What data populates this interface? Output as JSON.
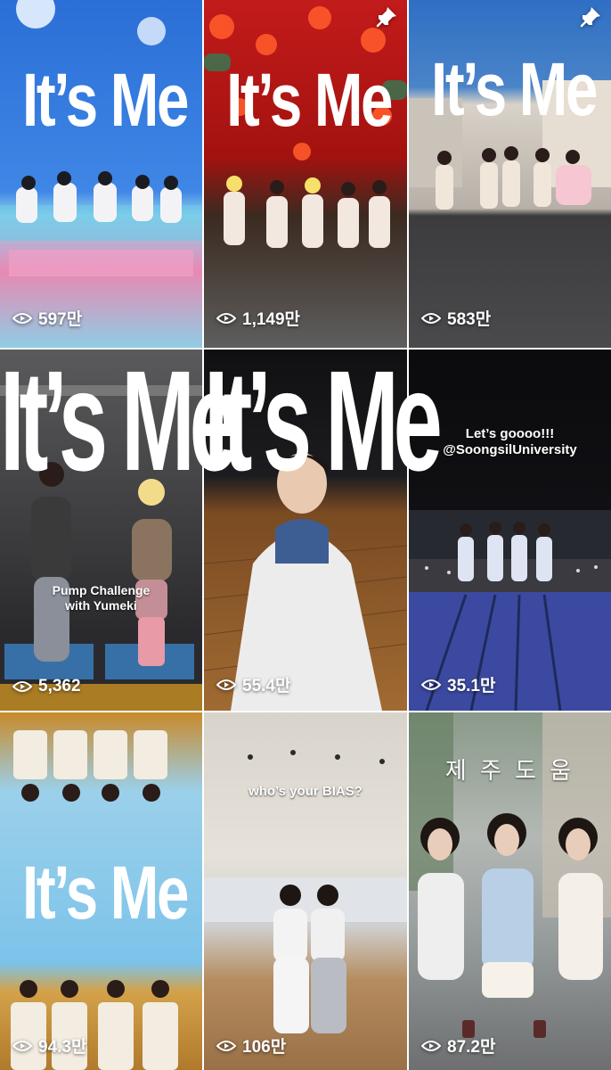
{
  "colors": {
    "overlay_text": "#ffffff"
  },
  "tiles": [
    {
      "title": "It’s Me",
      "views": "597만",
      "pinned": true
    },
    {
      "title": "It’s Me",
      "views": "1,149만",
      "pinned": true
    },
    {
      "title": "It’s Me",
      "views": "583만",
      "pinned": true
    },
    {
      "title": "It’s Me",
      "caption": "Pump Challenge\nwith Yumeki",
      "views": "5,362"
    },
    {
      "title": "It’s Me",
      "views": "55.4만"
    },
    {
      "caption": "Let’s goooo!!!\n@SoongsilUniversity",
      "views": "35.1만"
    },
    {
      "title": "It’s Me",
      "views": "94.3만"
    },
    {
      "caption": "who’s your BIAS?",
      "views": "106만"
    },
    {
      "caption": "제 주 도 움",
      "views": "87.2만"
    }
  ],
  "icons": {
    "views": "eye-play-icon",
    "pinned": "pin-icon"
  }
}
